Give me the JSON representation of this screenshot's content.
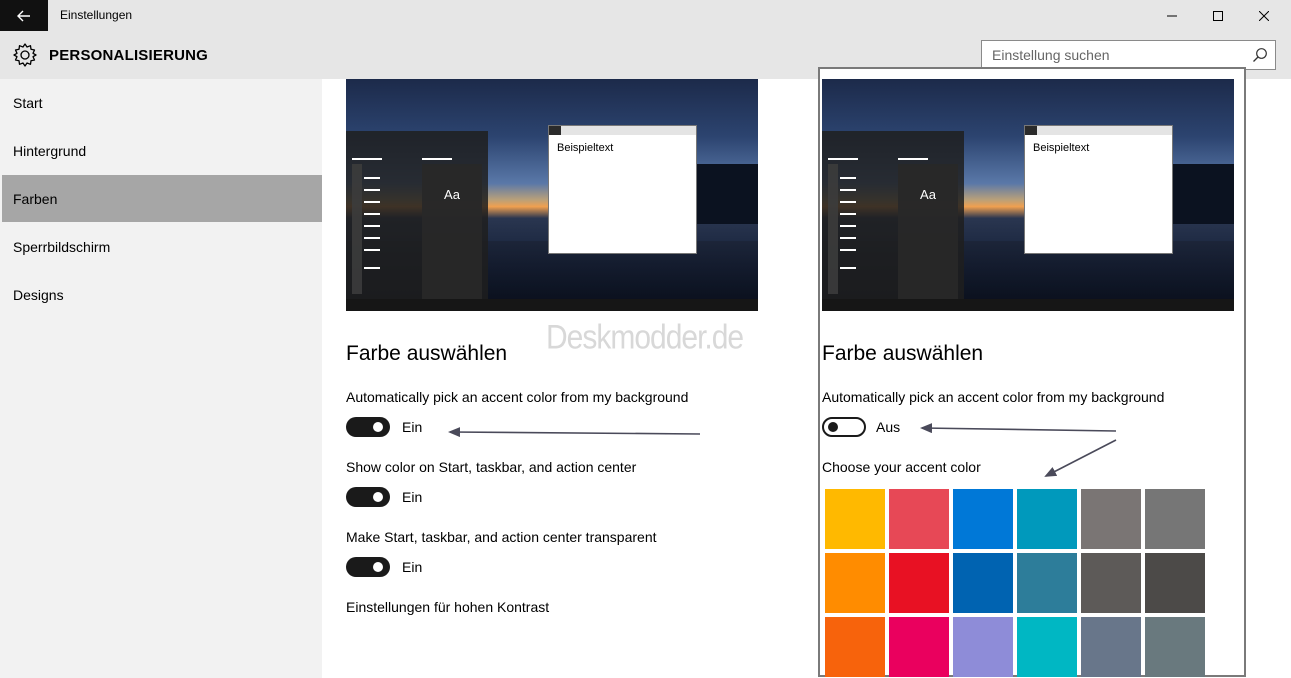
{
  "window": {
    "title": "Einstellungen",
    "back_icon": "arrow-left-icon",
    "controls": [
      "minimize-icon",
      "maximize-icon",
      "close-icon"
    ]
  },
  "header": {
    "title": "PERSONALISIERUNG",
    "icon": "gear-icon",
    "search_placeholder": "Einstellung suchen"
  },
  "sidebar": {
    "items": [
      {
        "label": "Start",
        "active": false
      },
      {
        "label": "Hintergrund",
        "active": false
      },
      {
        "label": "Farben",
        "active": true
      },
      {
        "label": "Sperrbildschirm",
        "active": false
      },
      {
        "label": "Designs",
        "active": false
      }
    ]
  },
  "left_panel": {
    "preview": {
      "tile_text": "Aa",
      "window_text": "Beispieltext"
    },
    "section_title": "Farbe auswählen",
    "auto_pick_label": "Automatically pick an accent color from my background",
    "auto_pick_state": "Ein",
    "show_color_label": "Show color on Start, taskbar, and action center",
    "show_color_state": "Ein",
    "transparent_label": "Make Start, taskbar, and action center transparent",
    "transparent_state": "Ein",
    "high_contrast_link": "Einstellungen für hohen Kontrast"
  },
  "right_panel": {
    "preview": {
      "tile_text": "Aa",
      "window_text": "Beispieltext"
    },
    "section_title": "Farbe auswählen",
    "auto_pick_label": "Automatically pick an accent color from my background",
    "auto_pick_state": "Aus",
    "accent_label": "Choose your accent color",
    "swatches": [
      "#ffb900",
      "#e74856",
      "#0078d7",
      "#0099bc",
      "#7a7574",
      "#767676",
      "#ff8c00",
      "#e81123",
      "#0063b1",
      "#2d7d9a",
      "#5d5a58",
      "#4c4a48",
      "#f7630c",
      "#ea005e",
      "#8e8cd8",
      "#00b7c3",
      "#68768a",
      "#69797e"
    ]
  },
  "watermark": "Deskmodder.de",
  "colors": {
    "toggle_on": "#1a1a1a",
    "sidebar_active": "#a6a6a6",
    "chrome": "#e6e6e6"
  }
}
